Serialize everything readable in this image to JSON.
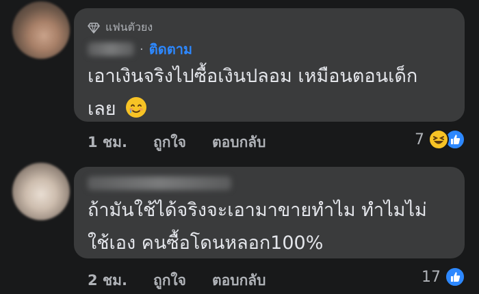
{
  "comments": [
    {
      "badge": "แฟนตัวยง",
      "follow_label": "ติดตาม",
      "text_line1": "เอาเงินจริงไปซื้อเงินปลอม เหมือนตอนเด็ก",
      "text_line2": "เลย",
      "text_emoji": "smiling-face-with-tear",
      "time": "1 ชม.",
      "like_label": "ถูกใจ",
      "reply_label": "ตอบกลับ",
      "reaction_count": "7",
      "reaction_icons": [
        "laughing-face-icon",
        "like-icon"
      ]
    },
    {
      "text_line1": "ถ้ามันใช้ได้จริงจะเอามาขายทำไม ทำไมไม่",
      "text_line2": "ใช้เอง คนซื้อโดนหลอก100%",
      "time": "2 ชม.",
      "like_label": "ถูกใจ",
      "reply_label": "ตอบกลับ",
      "reaction_count": "17",
      "reaction_icons": [
        "like-icon"
      ]
    }
  ],
  "colors": {
    "background": "#18191a",
    "bubble": "#3a3b3c",
    "link_blue": "#2d88ff",
    "muted_text": "#b0b3b8"
  }
}
